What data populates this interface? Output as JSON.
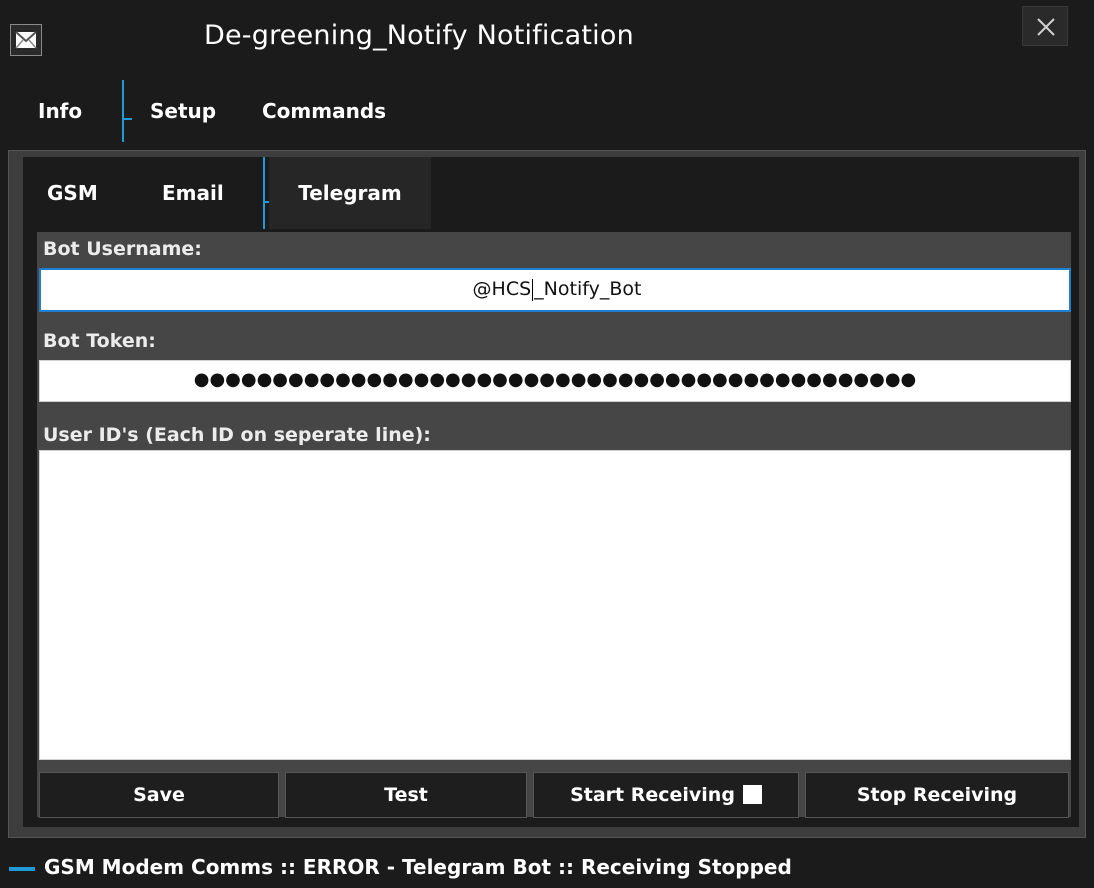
{
  "window": {
    "title": "De-greening_Notify Notification",
    "icon": "envelope-icon",
    "close_icon": "close-icon"
  },
  "tabs": [
    "Info",
    "Setup",
    "Commands"
  ],
  "subtabs": [
    "GSM",
    "Email",
    "Telegram"
  ],
  "active_subtab": "Telegram",
  "form": {
    "bot_username_label": "Bot Username:",
    "bot_username_before_caret": "@HCS",
    "bot_username_after_caret": "_Notify_Bot",
    "bot_token_label": "Bot Token:",
    "bot_token_value": "●●●●●●●●●●●●●●●●●●●●●●●●●●●●●●●●●●●●●●●●●●●●●●",
    "user_ids_label": "User ID's (Each ID on seperate line):",
    "user_ids_value": ""
  },
  "buttons": {
    "save": "Save",
    "test": "Test",
    "start_receiving": "Start Receiving",
    "stop_receiving": "Stop Receiving"
  },
  "status": {
    "text": "GSM Modem Comms :: ERROR - Telegram Bot :: Receiving Stopped"
  },
  "colors": {
    "accent": "#1e9bd7",
    "background": "#1b1b1b",
    "panel": "#464646"
  }
}
